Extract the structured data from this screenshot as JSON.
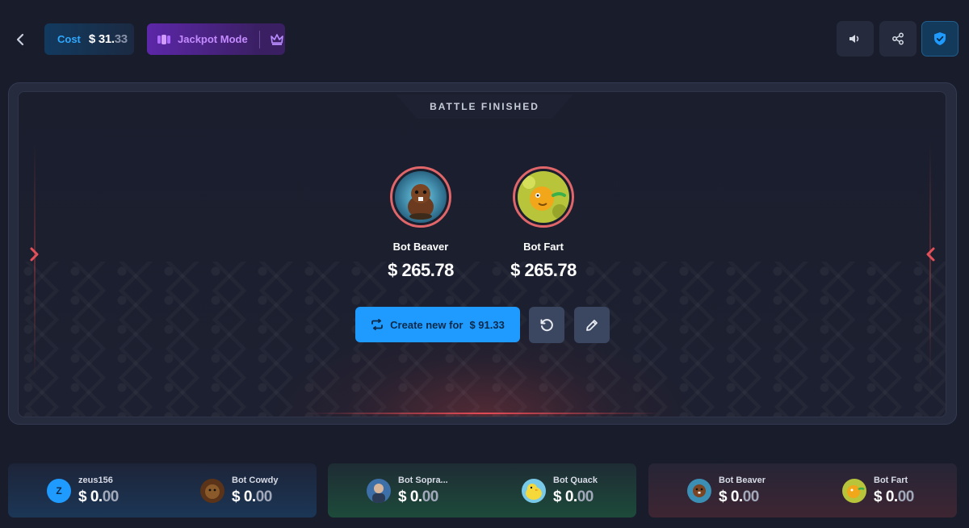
{
  "header": {
    "cost_label": "Cost",
    "cost_currency": "$",
    "cost_value_main": "31.",
    "cost_value_dim": "33",
    "jackpot_label": "Jackpot Mode"
  },
  "battle": {
    "status": "BATTLE FINISHED",
    "players": [
      {
        "name": "Bot Beaver",
        "amount": "$ 265.78",
        "avatar": "beaver-avatar"
      },
      {
        "name": "Bot Fart",
        "amount": "$ 265.78",
        "avatar": "fart-avatar"
      }
    ],
    "create_label": "Create new for",
    "create_amount": "$ 91.33"
  },
  "teams": [
    {
      "color": "blue",
      "slots": [
        {
          "name": "zeus156",
          "initial": "Z",
          "currency": "$ ",
          "amount_main": "0.",
          "amount_dim": "00"
        },
        {
          "name": "Bot Cowdy",
          "currency": "$ ",
          "amount_main": "0.",
          "amount_dim": "00"
        }
      ]
    },
    {
      "color": "green",
      "slots": [
        {
          "name": "Bot Sopra...",
          "currency": "$ ",
          "amount_main": "0.",
          "amount_dim": "00"
        },
        {
          "name": "Bot Quack",
          "currency": "$ ",
          "amount_main": "0.",
          "amount_dim": "00"
        }
      ]
    },
    {
      "color": "red",
      "slots": [
        {
          "name": "Bot Beaver",
          "currency": "$ ",
          "amount_main": "0.",
          "amount_dim": "00"
        },
        {
          "name": "Bot Fart",
          "currency": "$ ",
          "amount_main": "0.",
          "amount_dim": "00"
        }
      ]
    }
  ],
  "colors": {
    "accent_blue": "#1f9bff",
    "jackpot_purple": "#c48bff",
    "winner_ring": "#e0666a"
  }
}
